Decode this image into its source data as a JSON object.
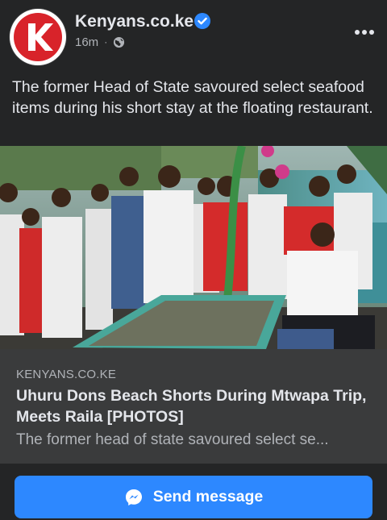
{
  "post": {
    "page_name": "Kenyans.co.ke",
    "time": "16m",
    "separator": "·",
    "caption": "The former Head of State savoured select seafood items during his short stay at the floating restaurant.",
    "verified": true,
    "audience_icon": "globe-icon",
    "menu_icon": "more-options-icon"
  },
  "link_preview": {
    "domain": "KENYANS.CO.KE",
    "title": "Uhuru Dons Beach Shorts During Mtwapa Trip, Meets Raila [PHOTOS]",
    "description": "The former head of state savoured select se..."
  },
  "cta": {
    "label": "Send message",
    "icon": "messenger-icon"
  },
  "colors": {
    "background": "#242526",
    "card": "#3a3b3c",
    "primary_text": "#e4e6eb",
    "secondary_text": "#b0b3b8",
    "button": "#2d88ff",
    "brand_red": "#d8232a"
  }
}
